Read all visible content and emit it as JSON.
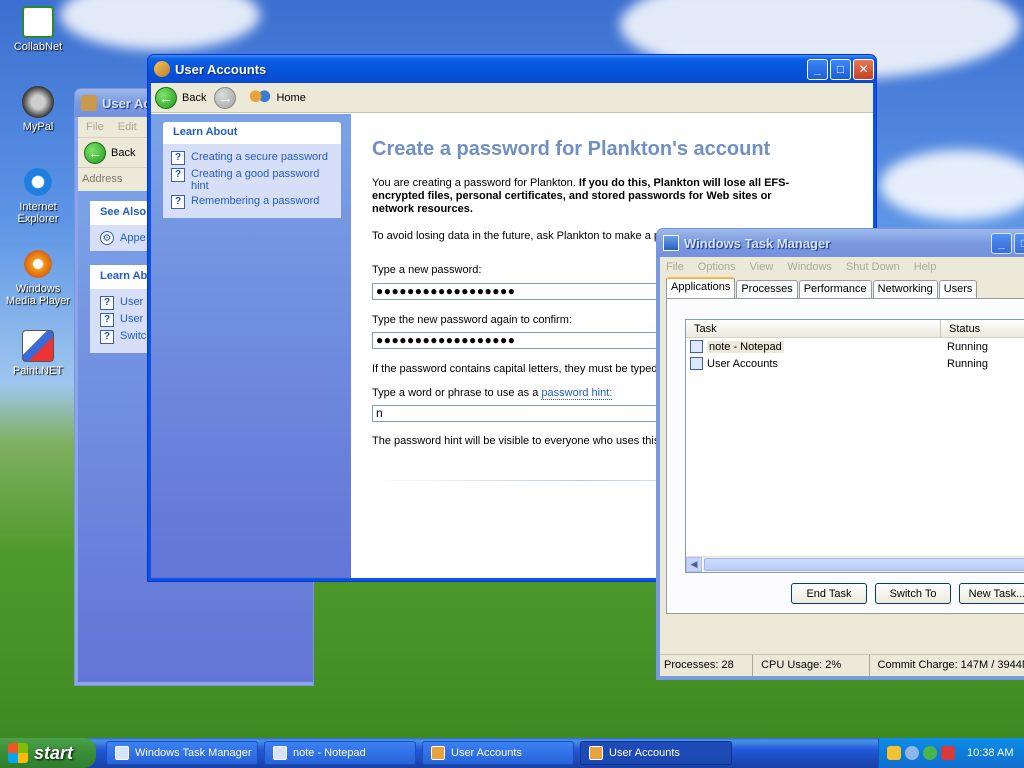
{
  "desktop": {
    "icons": [
      {
        "label": "CollabNet",
        "icon": "certificate-icon"
      },
      {
        "label": "MyPal",
        "icon": "raccoon-icon"
      },
      {
        "label": "Internet Explorer",
        "icon": "ie-icon"
      },
      {
        "label": "Windows Media Player",
        "icon": "media-player-icon"
      },
      {
        "label": "Paint.NET",
        "icon": "paint-icon"
      }
    ]
  },
  "back_window": {
    "title": "User Ac",
    "menu": [
      "File",
      "Edit"
    ],
    "back_label": "Back",
    "address_label": "Address",
    "see_also": {
      "title": "See Also",
      "items": [
        "Appe"
      ]
    },
    "learn_about": {
      "title": "Learn Ab",
      "items": [
        "User",
        "User",
        "Switc"
      ]
    }
  },
  "user_accounts": {
    "title": "User Accounts",
    "nav": {
      "back": "Back",
      "home": "Home"
    },
    "learn_about": {
      "title": "Learn About",
      "items": [
        "Creating a secure password",
        "Creating a good password hint",
        "Remembering a password"
      ]
    },
    "heading": "Create a password for Plankton's account",
    "intro_plain": "You are creating a password for Plankton.",
    "intro_bold": "If you do this, Plankton will lose all EFS-encrypted files, personal certificates, and stored passwords for Web sites or network resources.",
    "avoid_text": "To avoid losing data in the future, ask Plankton to make a p",
    "new_password_label": "Type a new password:",
    "new_password_value": "●●●●●●●●●●●●●●●●●●",
    "confirm_label": "Type the new password again to confirm:",
    "confirm_value": "●●●●●●●●●●●●●●●●●●",
    "caps_note": "If the password contains capital letters, they must be typed",
    "hint_label_prefix": "Type a word or phrase to use as a",
    "hint_link": "password hint:",
    "hint_value": "n",
    "hint_note": "The password hint will be visible to everyone who uses this"
  },
  "task_manager": {
    "title": "Windows Task Manager",
    "menu": [
      "File",
      "Options",
      "View",
      "Windows",
      "Shut Down",
      "Help"
    ],
    "tabs": [
      "Applications",
      "Processes",
      "Performance",
      "Networking",
      "Users"
    ],
    "columns": [
      "Task",
      "Status"
    ],
    "rows": [
      {
        "task": "note - Notepad",
        "status": "Running"
      },
      {
        "task": "User Accounts",
        "status": "Running"
      }
    ],
    "buttons": {
      "end_task": "End Task",
      "switch_to": "Switch To",
      "new_task": "New Task..."
    },
    "status": {
      "processes": "Processes: 28",
      "cpu": "CPU Usage: 2%",
      "commit": "Commit Charge: 147M / 3944M"
    }
  },
  "taskbar": {
    "start": "start",
    "buttons": [
      {
        "label": "Windows Task Manager"
      },
      {
        "label": "note - Notepad"
      },
      {
        "label": "User Accounts"
      },
      {
        "label": "User Accounts"
      }
    ],
    "clock": "10:38 AM"
  }
}
